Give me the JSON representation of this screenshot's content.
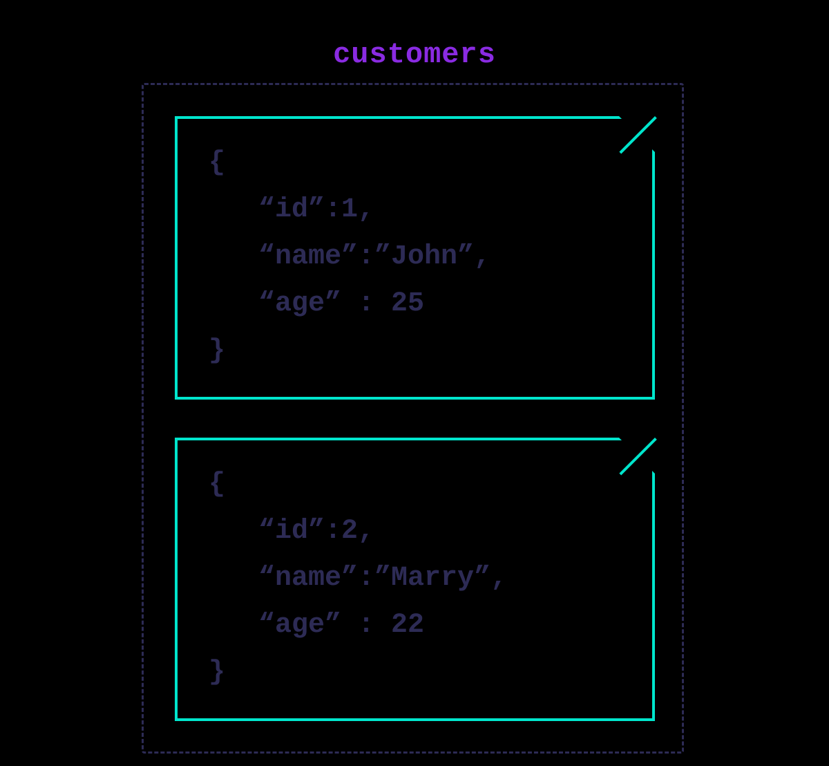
{
  "title": "customers",
  "documents": [
    {
      "lines": [
        "{",
        "   “id”:1,",
        "   “name”:”John”,",
        "   “age” : 25",
        "}"
      ],
      "data": {
        "id": 1,
        "name": "John",
        "age": 25
      }
    },
    {
      "lines": [
        "{",
        "   “id”:2,",
        "   “name”:”Marry”,",
        "   “age” : 22",
        "}"
      ],
      "data": {
        "id": 2,
        "name": "Marry",
        "age": 22
      }
    }
  ],
  "colors": {
    "background": "#000000",
    "title": "#8a2be2",
    "documentBorder": "#00e5cc",
    "collectionBorder": "#2d2b55",
    "codeText": "#2d2b55"
  }
}
